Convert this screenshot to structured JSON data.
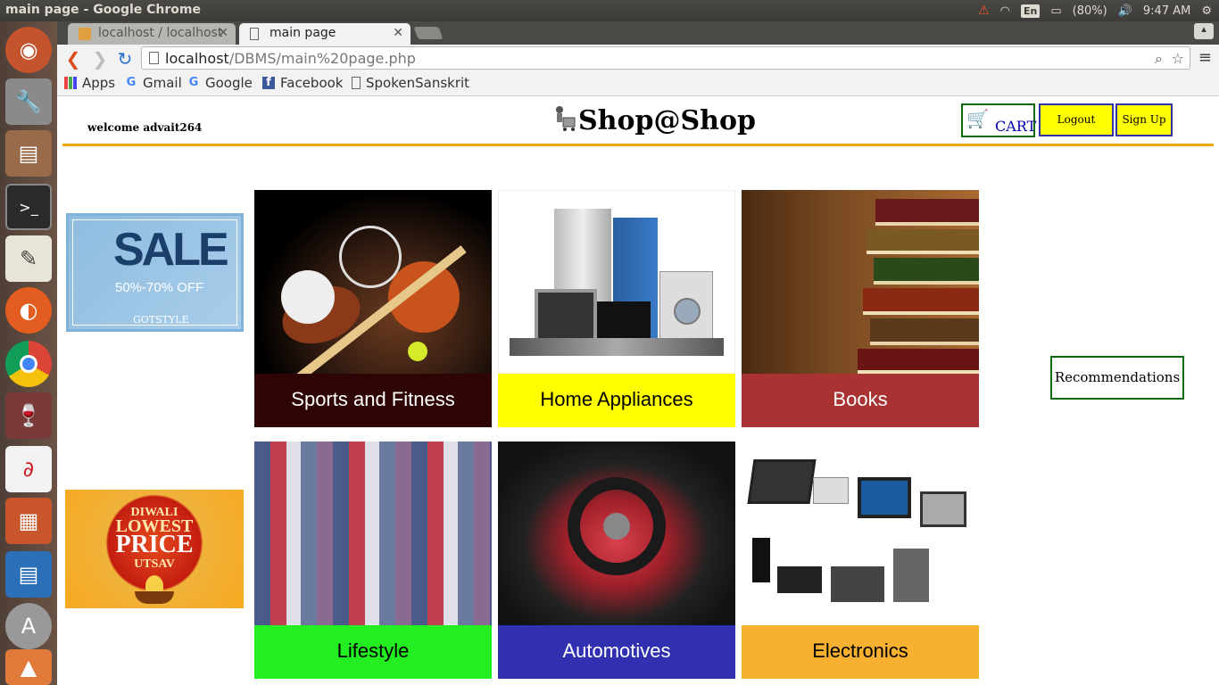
{
  "os_panel": {
    "window_title": "main page - Google Chrome",
    "language": "En",
    "battery": "(80%)",
    "clock": "9:47 AM"
  },
  "browser": {
    "tabs": [
      {
        "label": "localhost / localhost",
        "active": false
      },
      {
        "label": "main page",
        "active": true
      }
    ],
    "url_host": "localhost",
    "url_path": "/DBMS/main%20page.php",
    "bookmarks": [
      "Apps",
      "Gmail",
      "Google",
      "Facebook",
      "SpokenSanskrit"
    ]
  },
  "page": {
    "welcome": "welcome advait264",
    "brand": "Shop@Shop",
    "cart_label": "CART",
    "logout_label": "Logout",
    "signup_label": "Sign Up",
    "recommendations_label": "Recommendations",
    "ads": {
      "sale": {
        "headline": "SALE",
        "offer": "50%-70% OFF",
        "brand": "GOTSTYLE"
      },
      "diwali": {
        "line1": "DIWALI",
        "line2": "LOWEST",
        "line3": "PRICE",
        "line4": "UTSAV"
      }
    },
    "categories": [
      {
        "label": "Sports and Fitness",
        "band_color": "#2e0404"
      },
      {
        "label": "Home Appliances",
        "band_color": "#ffff00"
      },
      {
        "label": "Books",
        "band_color": "#a93232"
      },
      {
        "label": "Lifestyle",
        "band_color": "#22ee22"
      },
      {
        "label": "Automotives",
        "band_color": "#3030b0"
      },
      {
        "label": "Electronics",
        "band_color": "#f7b030"
      }
    ]
  },
  "colors": {
    "header_rule": "#f0a500",
    "button_yellow": "#ffff00",
    "cart_border": "#0a6a0a"
  }
}
